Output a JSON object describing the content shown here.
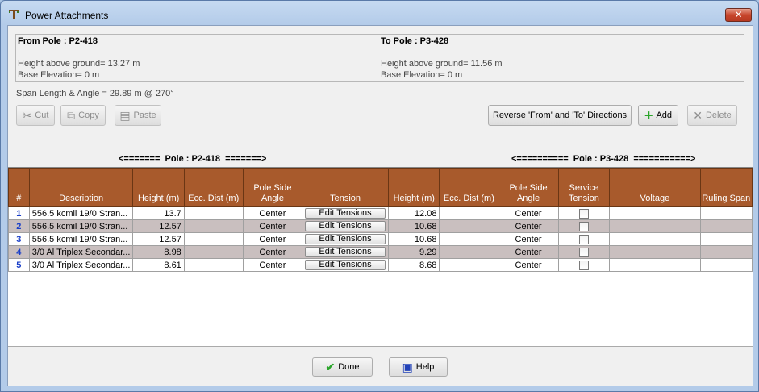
{
  "window": {
    "title": "Power Attachments",
    "close_label": "✕"
  },
  "from_pole": {
    "heading": "From Pole : P2-418",
    "height": "Height above ground= 13.27 m",
    "base": "Base Elevation= 0 m"
  },
  "to_pole": {
    "heading": "To Pole : P3-428",
    "height": "Height above ground= 11.56 m",
    "base": "Base Elevation= 0 m"
  },
  "span": "Span Length & Angle = 29.89 m @ 270°",
  "toolbar": {
    "cut": "Cut",
    "copy": "Copy",
    "paste": "Paste",
    "reverse": "Reverse 'From' and 'To' Directions",
    "add": "Add",
    "delete": "Delete"
  },
  "pole_labels": {
    "left": "<=======  Pole : P2-418  =======>",
    "right": "<==========  Pole : P3-428  ===========>"
  },
  "columns": [
    "#",
    "Description",
    "Height (m)",
    "Ecc. Dist (m)",
    "Pole Side Angle",
    "Tension",
    "Height (m)",
    "Ecc. Dist (m)",
    "Pole Side Angle",
    "Service Tension",
    "Voltage",
    "Ruling Span"
  ],
  "rows": [
    {
      "idx": "1",
      "desc": "556.5 kcmil 19/0 Stran...",
      "h1": "13.7",
      "e1": "",
      "a1": "Center",
      "tension": "Edit Tensions",
      "h2": "12.08",
      "e2": "",
      "a2": "Center",
      "voltage": "",
      "ruling": ""
    },
    {
      "idx": "2",
      "desc": "556.5 kcmil 19/0 Stran...",
      "h1": "12.57",
      "e1": "",
      "a1": "Center",
      "tension": "Edit Tensions",
      "h2": "10.68",
      "e2": "",
      "a2": "Center",
      "voltage": "",
      "ruling": ""
    },
    {
      "idx": "3",
      "desc": "556.5 kcmil 19/0 Stran...",
      "h1": "12.57",
      "e1": "",
      "a1": "Center",
      "tension": "Edit Tensions",
      "h2": "10.68",
      "e2": "",
      "a2": "Center",
      "voltage": "",
      "ruling": ""
    },
    {
      "idx": "4",
      "desc": "3/0 Al Triplex Secondar...",
      "h1": "8.98",
      "e1": "",
      "a1": "Center",
      "tension": "Edit Tensions",
      "h2": "9.29",
      "e2": "",
      "a2": "Center",
      "voltage": "",
      "ruling": ""
    },
    {
      "idx": "5",
      "desc": "3/0 Al Triplex Secondar...",
      "h1": "8.61",
      "e1": "",
      "a1": "Center",
      "tension": "Edit Tensions",
      "h2": "8.68",
      "e2": "",
      "a2": "Center",
      "voltage": "",
      "ruling": ""
    }
  ],
  "footer": {
    "done": "Done",
    "help": "Help"
  },
  "colors": {
    "header_bg": "#a85a2c",
    "row_alt": "#c9bfbf",
    "index_text": "#1a3fc9",
    "add_icon": "#2aa52a"
  }
}
